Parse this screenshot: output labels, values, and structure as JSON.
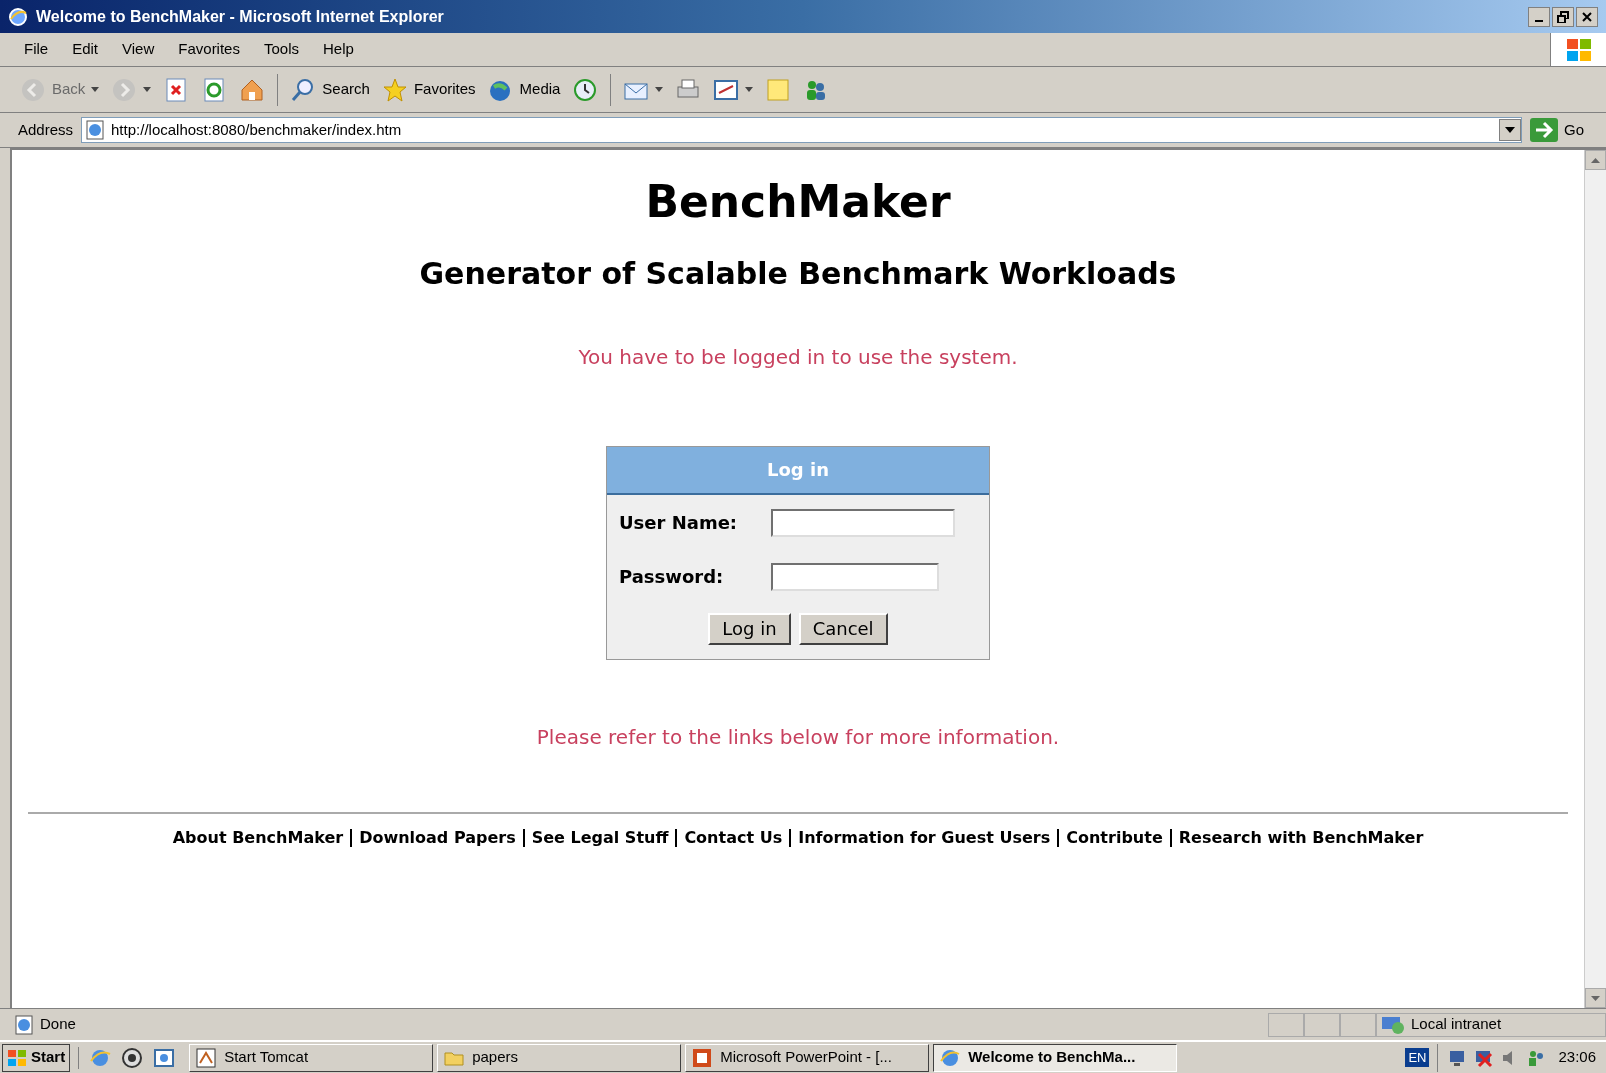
{
  "window": {
    "title": "Welcome to BenchMaker - Microsoft Internet Explorer"
  },
  "menu": [
    "File",
    "Edit",
    "View",
    "Favorites",
    "Tools",
    "Help"
  ],
  "toolbar": [
    {
      "kind": "back",
      "label": "Back",
      "disabled": true
    },
    {
      "kind": "forward",
      "disabled": true
    },
    {
      "kind": "stop",
      "disabled": false
    },
    {
      "kind": "refresh",
      "disabled": false
    },
    {
      "kind": "home",
      "disabled": false
    },
    {
      "kind": "search",
      "label": "Search",
      "disabled": false
    },
    {
      "kind": "favorites",
      "label": "Favorites",
      "disabled": false
    },
    {
      "kind": "media",
      "label": "Media",
      "disabled": false
    },
    {
      "kind": "history",
      "disabled": false
    },
    {
      "kind": "mail",
      "disabled": false
    },
    {
      "kind": "print",
      "disabled": false
    },
    {
      "kind": "edit",
      "disabled": false
    },
    {
      "kind": "note",
      "disabled": false
    },
    {
      "kind": "messenger",
      "disabled": false
    }
  ],
  "address": {
    "label": "Address",
    "value": "http://localhost:8080/benchmaker/index.htm",
    "go": "Go"
  },
  "page": {
    "title": "BenchMaker",
    "subtitle": "Generator of Scalable Benchmark Workloads",
    "notice": "You have to be logged in to use the system.",
    "login": {
      "header": "Log in",
      "fields": [
        {
          "label": "User Name:",
          "kind": "text"
        },
        {
          "label": "Password:",
          "kind": "password"
        }
      ],
      "buttons": [
        "Log in",
        "Cancel"
      ]
    },
    "info": "Please refer to the links below for more information.",
    "links": [
      "About BenchMaker",
      "Download Papers",
      "See Legal Stuff",
      "Contact Us",
      "Information for Guest Users",
      "Contribute",
      "Research with BenchMaker"
    ]
  },
  "status_bar": {
    "text": "Done",
    "zone": "Local intranet"
  },
  "taskbar": {
    "start": "Start",
    "tasks": [
      {
        "label": "Start Tomcat",
        "kind": "app",
        "selected": false
      },
      {
        "label": "papers",
        "kind": "folder",
        "selected": false
      },
      {
        "label": "Microsoft PowerPoint - [...",
        "kind": "ppt",
        "selected": false
      },
      {
        "label": "Welcome to BenchMa...",
        "kind": "ie",
        "selected": true
      }
    ],
    "language": "EN",
    "clock": "23:06"
  }
}
